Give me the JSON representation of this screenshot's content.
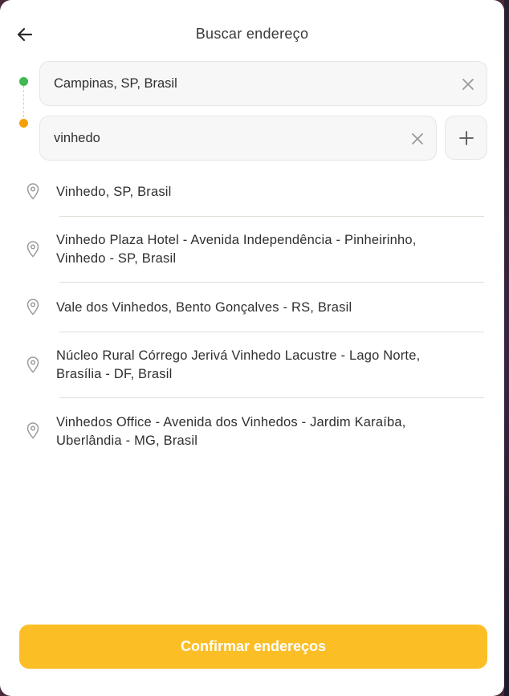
{
  "header": {
    "title": "Buscar endereço",
    "back_icon": "arrow-left-icon"
  },
  "route": {
    "origin": {
      "value": "Campinas, SP, Brasil",
      "dot_color": "#3fb950",
      "clear_icon": "close-icon"
    },
    "destination": {
      "value": "vinhedo",
      "dot_color": "#f5a00b",
      "clear_icon": "close-icon"
    },
    "add_stop_icon": "plus-icon"
  },
  "results": [
    {
      "line1": "Vinhedo, SP, Brasil",
      "line2": ""
    },
    {
      "line1": "Vinhedo Plaza Hotel - Avenida Independência - Pinheirinho,",
      "line2": "Vinhedo - SP, Brasil"
    },
    {
      "line1": "Vale dos Vinhedos, Bento Gonçalves - RS, Brasil",
      "line2": ""
    },
    {
      "line1": "Núcleo Rural Córrego Jerivá Vinhedo Lacustre - Lago Norte,",
      "line2": "Brasília - DF, Brasil"
    },
    {
      "line1": "Vinhedos Office - Avenida dos Vinhedos - Jardim Karaíba,",
      "line2": "Uberlândia - MG, Brasil"
    }
  ],
  "result_icon": "map-pin-icon",
  "footer": {
    "confirm_label": "Confirmar endereços",
    "accent_color": "#fbbe25"
  }
}
